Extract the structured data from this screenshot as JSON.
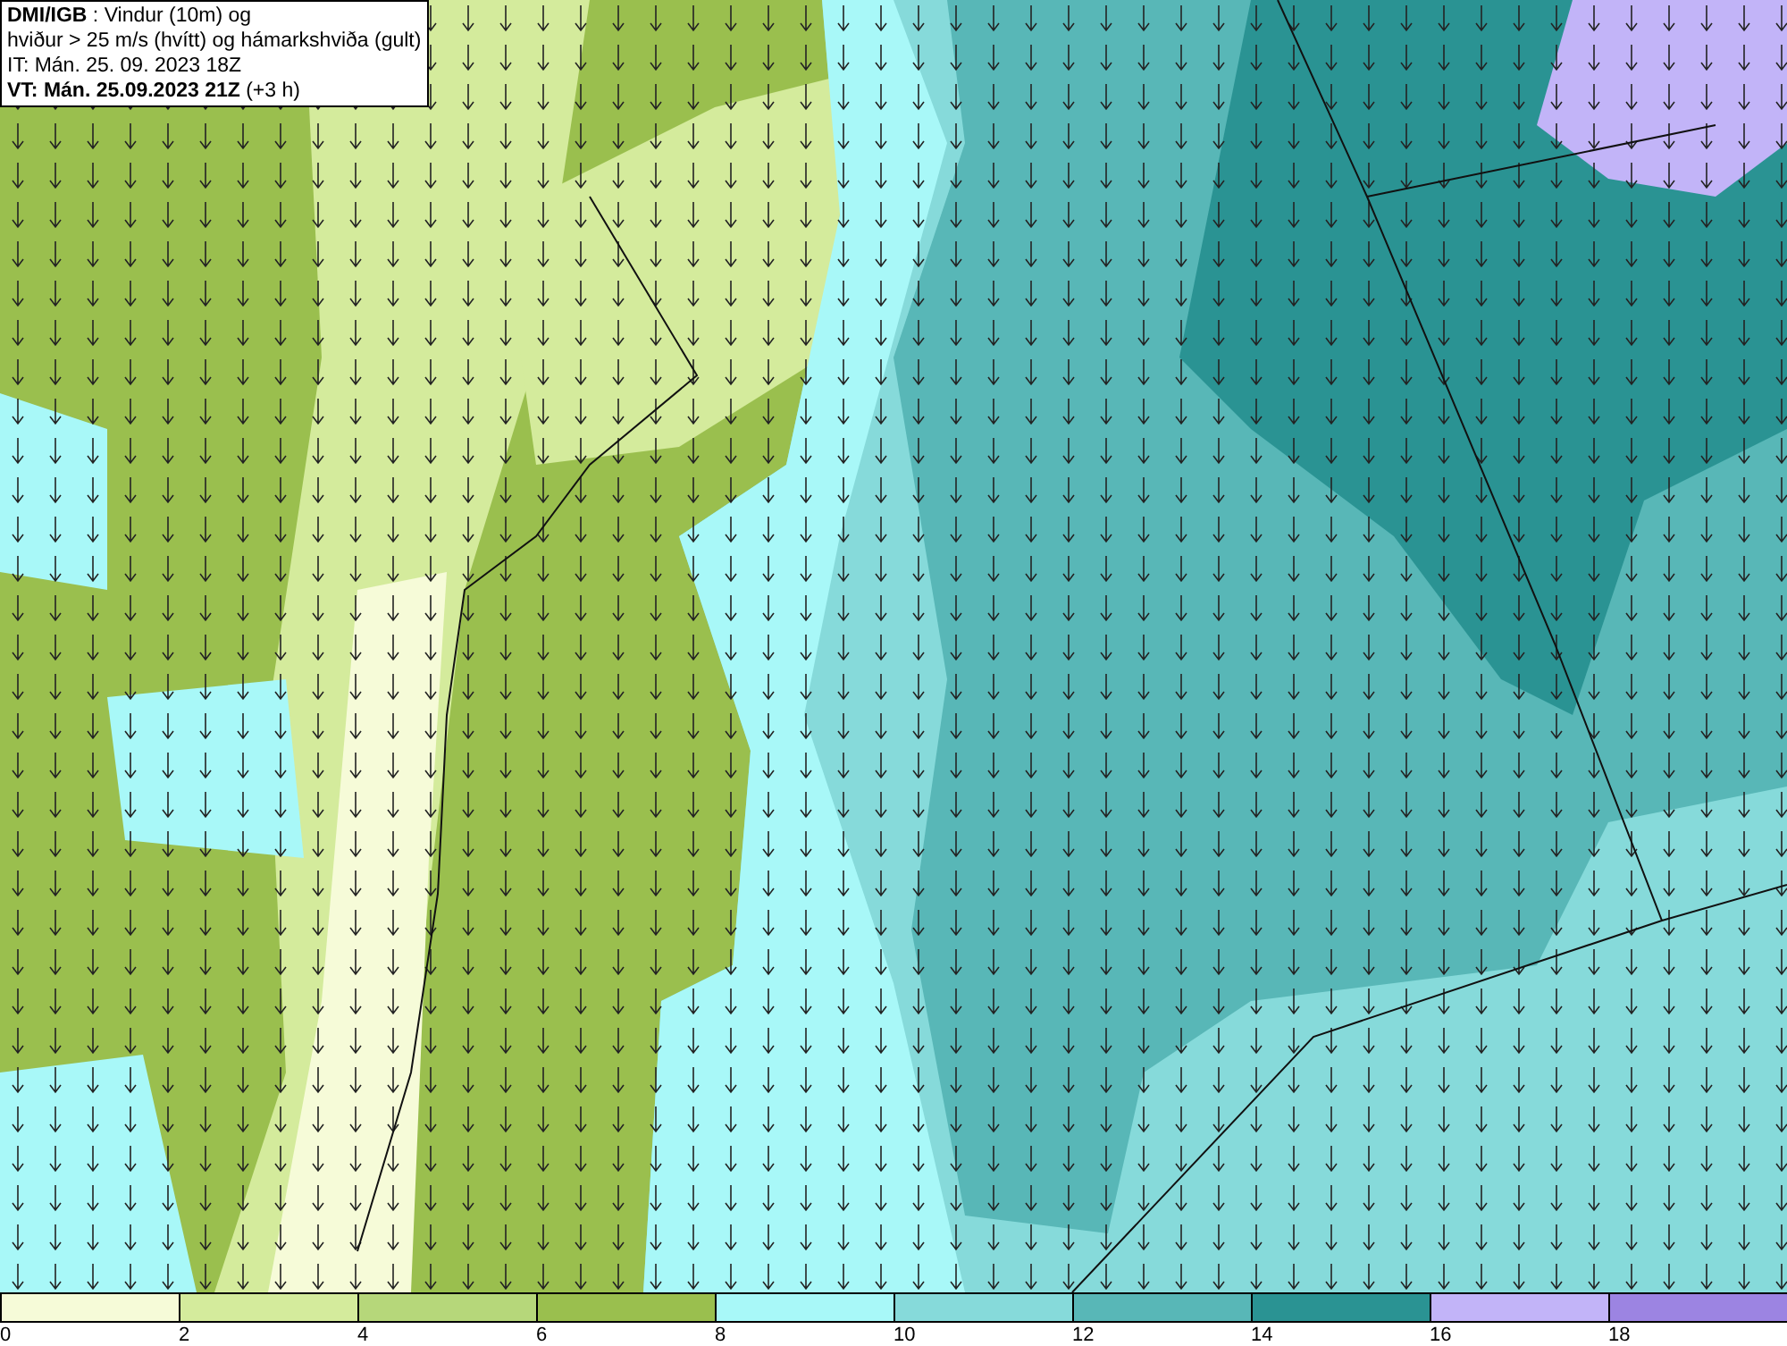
{
  "title_box": {
    "lines": [
      "**DMI/IGB** : Vindur (10m) og",
      "hviður > 25 m/s (hvítt) og hámarkshviða (gult)",
      "IT: Mán. 25. 09. 2023 18Z",
      "**VT: Mán. 25.09.2023 21Z** (+3 h)"
    ]
  },
  "legend": {
    "bins": [
      {
        "color": "#f6fbd8"
      },
      {
        "color": "#d4eb9c"
      },
      {
        "color": "#b6d77a"
      },
      {
        "color": "#9abf4e"
      },
      {
        "color": "#a8f8f8"
      },
      {
        "color": "#86dada"
      },
      {
        "color": "#58b7b7"
      },
      {
        "color": "#2a9393"
      },
      {
        "color": "#c2b4f8"
      },
      {
        "color": "#9c84e2"
      }
    ],
    "ticks": [
      "0",
      "2",
      "4",
      "6",
      "8",
      "10",
      "12",
      "14",
      "16",
      "18"
    ]
  }
}
